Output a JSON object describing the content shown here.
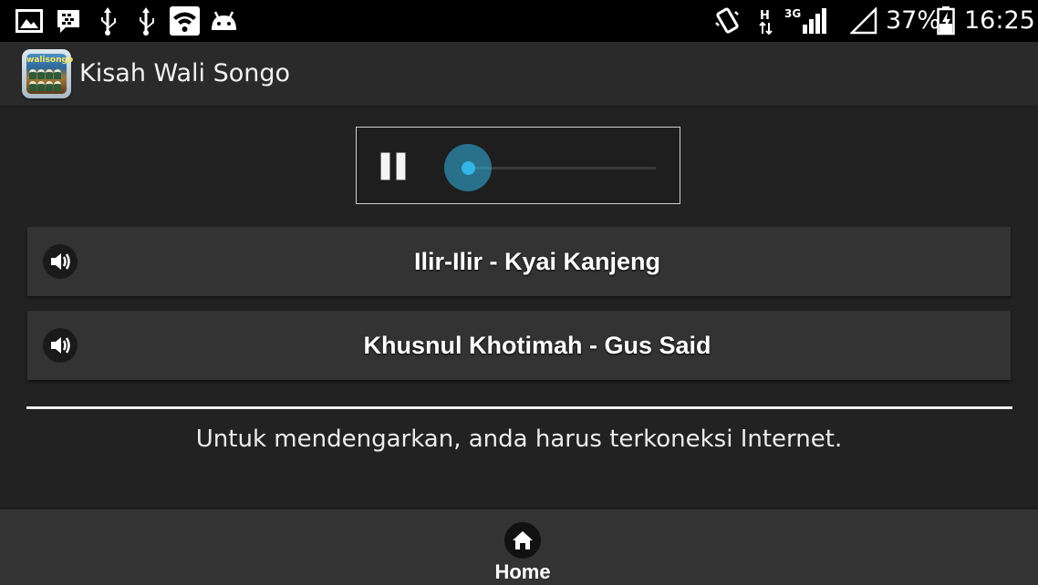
{
  "status_bar": {
    "battery": "37%",
    "time": "16:25",
    "network_type": "3G",
    "network_mode": "H",
    "icons": [
      "gallery-icon",
      "bbm-icon",
      "usb-icon",
      "usb-icon",
      "wifi-icon",
      "android-icon",
      "vibrate-icon",
      "data-activity-icon",
      "signal-icon",
      "no-sim-signal-icon",
      "battery-charging-icon"
    ]
  },
  "app": {
    "title": "Kisah Wali Songo",
    "icon_text": "walisongo"
  },
  "player": {
    "state": "playing",
    "progress": 0.0,
    "accent_color": "#33b5e5"
  },
  "songs": [
    {
      "label": "Ilir-Ilir - Kyai Kanjeng",
      "icon": "speaker-icon"
    },
    {
      "label": "Khusnul Khotimah - Gus Said",
      "icon": "speaker-icon"
    }
  ],
  "notice": "Untuk mendengarkan, anda harus terkoneksi Internet.",
  "bottom_nav": {
    "home_label": "Home",
    "home_icon": "home-icon"
  }
}
